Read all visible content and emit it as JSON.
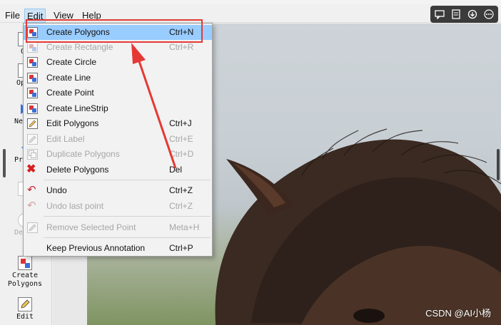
{
  "menubar": {
    "items": [
      "File",
      "Edit",
      "View",
      "Help"
    ]
  },
  "toolbar": {
    "tools": [
      {
        "label": "Op",
        "dim": false
      },
      {
        "label": "Op D",
        "dim": false
      },
      {
        "label": "Ne Im",
        "dim": false
      },
      {
        "label": "Pr Im",
        "dim": false
      },
      {
        "label": "S",
        "dim": true
      },
      {
        "label": "Del F",
        "dim": true
      },
      {
        "label": "Create Polygons",
        "dim": false
      },
      {
        "label": "Edit",
        "dim": false
      }
    ]
  },
  "edit_menu": {
    "items": [
      {
        "label": "Create Polygons",
        "shortcut": "Ctrl+N",
        "enabled": true,
        "highlighted": true
      },
      {
        "label": "Create Rectangle",
        "shortcut": "Ctrl+R",
        "enabled": false
      },
      {
        "label": "Create Circle",
        "shortcut": "",
        "enabled": true
      },
      {
        "label": "Create Line",
        "shortcut": "",
        "enabled": true
      },
      {
        "label": "Create Point",
        "shortcut": "",
        "enabled": true
      },
      {
        "label": "Create LineStrip",
        "shortcut": "",
        "enabled": true
      },
      {
        "label": "Edit Polygons",
        "shortcut": "Ctrl+J",
        "enabled": true
      },
      {
        "label": "Edit Label",
        "shortcut": "Ctrl+E",
        "enabled": false
      },
      {
        "label": "Duplicate Polygons",
        "shortcut": "Ctrl+D",
        "enabled": false
      },
      {
        "label": "Delete Polygons",
        "shortcut": "Del",
        "enabled": true
      },
      {
        "label": "Undo",
        "shortcut": "Ctrl+Z",
        "enabled": true
      },
      {
        "label": "Undo last point",
        "shortcut": "Ctrl+Z",
        "enabled": false
      },
      {
        "label": "Remove Selected Point",
        "shortcut": "Meta+H",
        "enabled": false
      },
      {
        "label": "Keep Previous Annotation",
        "shortcut": "Ctrl+P",
        "enabled": true
      }
    ]
  },
  "watermark": "CSDN @AI小杨",
  "colors": {
    "highlight": "#99ccff",
    "callout": "#e53935"
  }
}
